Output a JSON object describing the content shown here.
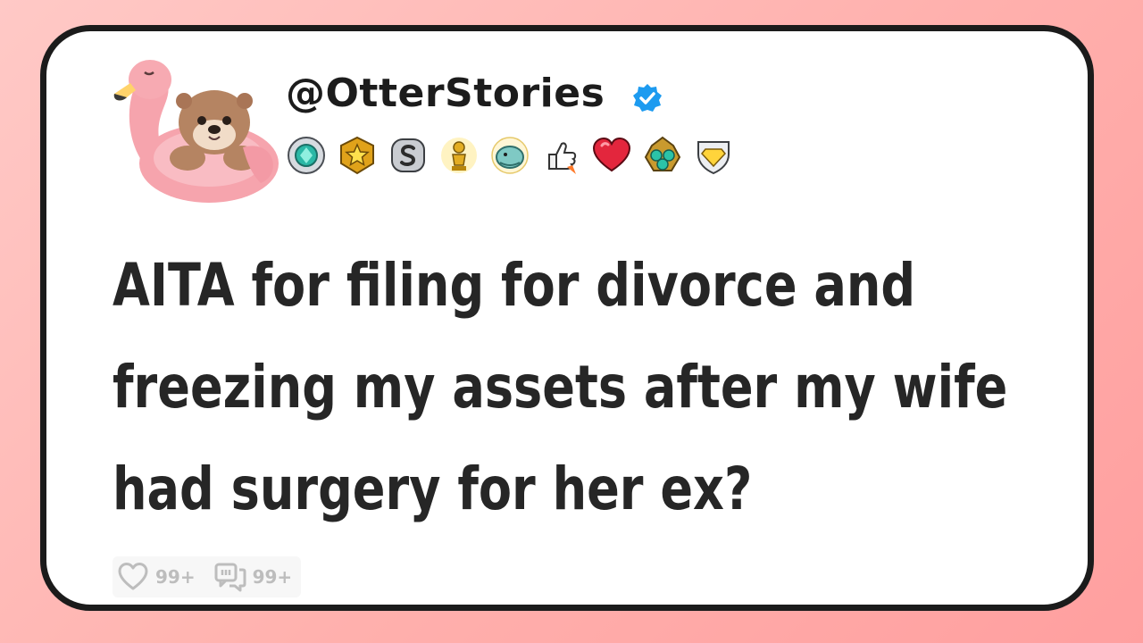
{
  "post": {
    "username": "@OtterStories",
    "verified": true,
    "title_lines": [
      "AITA for filing for divorce and",
      "freezing my assets after my wife",
      "had surgery for her ex?"
    ],
    "likes": "99+",
    "comments": "99+"
  },
  "badges": [
    "gem-medal-icon",
    "star-badge-icon",
    "s-coin-badge-icon",
    "trophy-figure-icon",
    "wave-creature-icon",
    "thumbs-up-rocket-icon",
    "heart-badge-icon",
    "triple-gem-crest-icon",
    "diamond-shield-icon"
  ],
  "colors": {
    "background": "#ffb0ad",
    "card": "#ffffff",
    "card_border": "#1b1b1b",
    "text": "#262626",
    "verified": "#1d9bf0",
    "stats": "#bdbdbd"
  }
}
